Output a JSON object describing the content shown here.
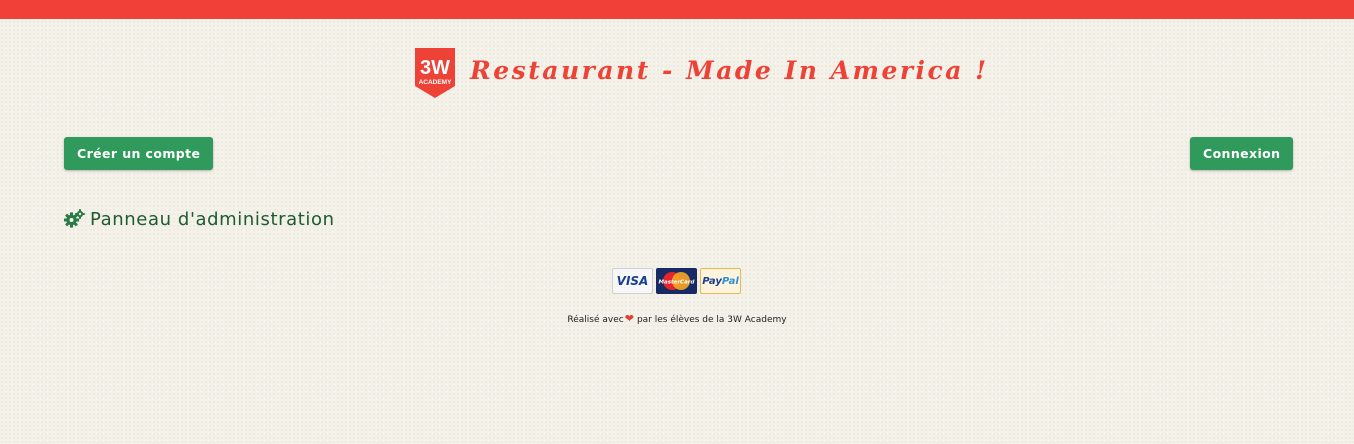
{
  "colors": {
    "top_bar": "#f04038",
    "title": "#ee4237",
    "button_bg": "#2f9a5c",
    "admin_text": "#1e5a32",
    "background": "#f4f1e8",
    "heart": "#e53c33"
  },
  "header": {
    "logo_text": "3W",
    "logo_subtext": "ACADEMY",
    "title": "Restaurant - Made In America !"
  },
  "nav": {
    "create_account_label": "Créer un compte",
    "login_label": "Connexion"
  },
  "admin": {
    "icon": "gears-icon",
    "label": "Panneau d'administration"
  },
  "payments": {
    "cards": [
      "Visa",
      "MasterCard",
      "PayPal"
    ],
    "visa_label": "VISA",
    "mastercard_label": "MasterCard",
    "paypal_pay": "Pay",
    "paypal_pal": "Pal"
  },
  "footer": {
    "text_before": "Réalisé avec",
    "heart_icon": "heart-icon",
    "text_after": "par les élèves de la 3W Academy"
  }
}
